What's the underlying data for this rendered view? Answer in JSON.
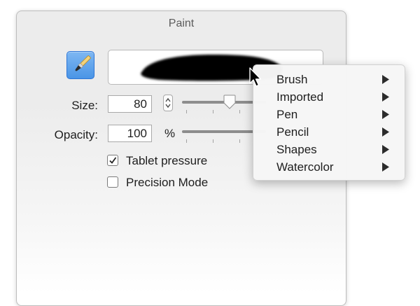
{
  "panel": {
    "title": "Paint",
    "tool_icon": "paintbrush-icon",
    "size": {
      "label": "Size:",
      "value": "80",
      "slider_fraction": 0.33
    },
    "opacity": {
      "label": "Opacity:",
      "value": "100",
      "unit": "%"
    },
    "tablet_pressure": {
      "label": "Tablet pressure",
      "checked": true
    },
    "precision_mode": {
      "label": "Precision Mode",
      "checked": false
    }
  },
  "menu": {
    "items": [
      {
        "label": "Brush"
      },
      {
        "label": "Imported"
      },
      {
        "label": "Pen"
      },
      {
        "label": "Pencil"
      },
      {
        "label": "Shapes"
      },
      {
        "label": "Watercolor"
      }
    ],
    "arrow_icon": "triangle-right-icon"
  },
  "colors": {
    "accent": "#4a95e6",
    "stroke": "#000000"
  }
}
